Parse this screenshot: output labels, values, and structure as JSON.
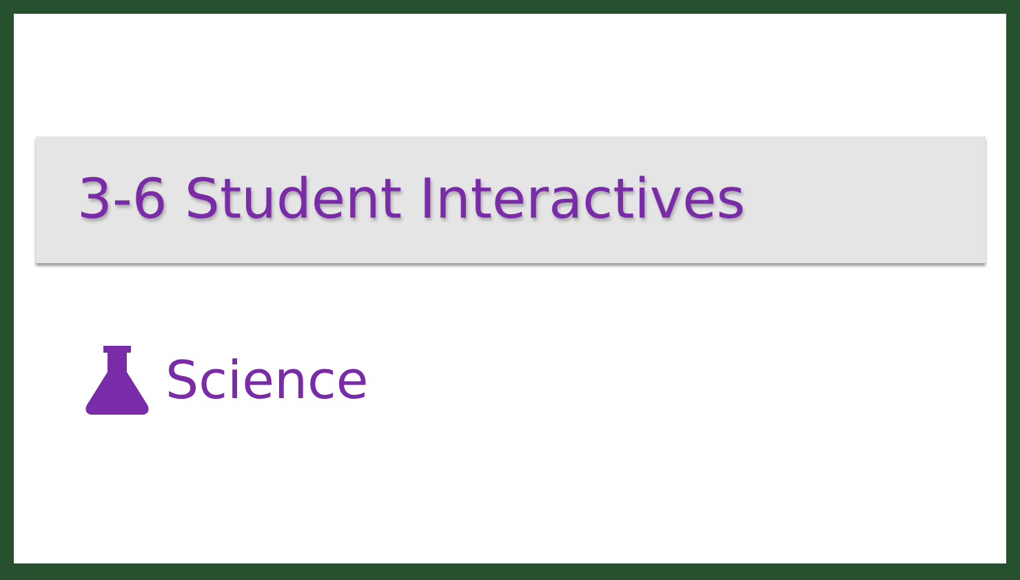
{
  "header": {
    "title": "3-6 Student Interactives"
  },
  "links": [
    {
      "label": "Science"
    }
  ]
}
